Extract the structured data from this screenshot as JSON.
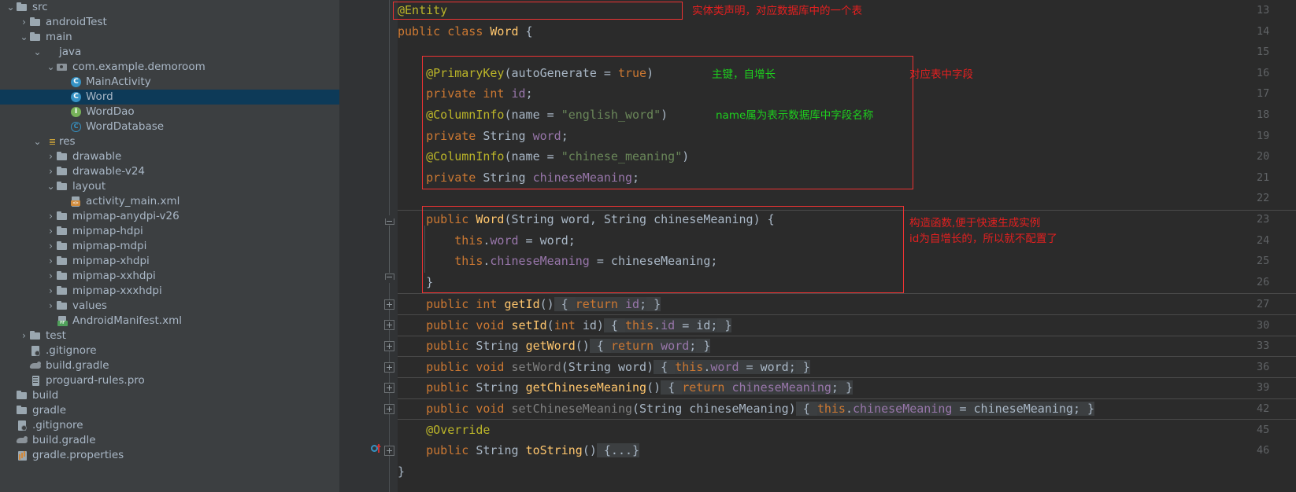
{
  "sidebar": {
    "items": [
      {
        "label": "src",
        "depth": 1,
        "arrow": "▾",
        "icon": "folder",
        "indent": 7
      },
      {
        "label": "androidTest",
        "depth": 2,
        "arrow": "›",
        "icon": "folder",
        "indent": 24
      },
      {
        "label": "main",
        "depth": 2,
        "arrow": "▾",
        "icon": "folder",
        "indent": 24
      },
      {
        "label": "java",
        "depth": 3,
        "arrow": "▾",
        "icon": "folder-blue",
        "indent": 41
      },
      {
        "label": "com.example.demoroom",
        "depth": 4,
        "arrow": "▾",
        "icon": "pkg",
        "indent": 58
      },
      {
        "label": "MainActivity",
        "depth": 5,
        "arrow": "",
        "icon": "cls",
        "indent": 75
      },
      {
        "label": "Word",
        "depth": 5,
        "arrow": "",
        "icon": "cls",
        "indent": 75,
        "selected": true
      },
      {
        "label": "WordDao",
        "depth": 5,
        "arrow": "",
        "icon": "iface",
        "indent": 75
      },
      {
        "label": "WordDatabase",
        "depth": 5,
        "arrow": "",
        "icon": "absc",
        "indent": 75
      },
      {
        "label": "res",
        "depth": 3,
        "arrow": "▾",
        "icon": "folder-res",
        "indent": 41
      },
      {
        "label": "drawable",
        "depth": 4,
        "arrow": "›",
        "icon": "folder",
        "indent": 58
      },
      {
        "label": "drawable-v24",
        "depth": 4,
        "arrow": "›",
        "icon": "folder",
        "indent": 58
      },
      {
        "label": "layout",
        "depth": 4,
        "arrow": "▾",
        "icon": "folder",
        "indent": 58
      },
      {
        "label": "activity_main.xml",
        "depth": 5,
        "arrow": "",
        "icon": "xml",
        "indent": 75
      },
      {
        "label": "mipmap-anydpi-v26",
        "depth": 4,
        "arrow": "›",
        "icon": "folder",
        "indent": 58
      },
      {
        "label": "mipmap-hdpi",
        "depth": 4,
        "arrow": "›",
        "icon": "folder",
        "indent": 58
      },
      {
        "label": "mipmap-mdpi",
        "depth": 4,
        "arrow": "›",
        "icon": "folder",
        "indent": 58
      },
      {
        "label": "mipmap-xhdpi",
        "depth": 4,
        "arrow": "›",
        "icon": "folder",
        "indent": 58
      },
      {
        "label": "mipmap-xxhdpi",
        "depth": 4,
        "arrow": "›",
        "icon": "folder",
        "indent": 58
      },
      {
        "label": "mipmap-xxxhdpi",
        "depth": 4,
        "arrow": "›",
        "icon": "folder",
        "indent": 58
      },
      {
        "label": "values",
        "depth": 4,
        "arrow": "›",
        "icon": "folder",
        "indent": 58
      },
      {
        "label": "AndroidManifest.xml",
        "depth": 4,
        "arrow": "",
        "icon": "mf",
        "indent": 58
      },
      {
        "label": "test",
        "depth": 2,
        "arrow": "›",
        "icon": "folder",
        "indent": 24
      },
      {
        "label": ".gitignore",
        "depth": 2,
        "arrow": "",
        "icon": "git",
        "indent": 24
      },
      {
        "label": "build.gradle",
        "depth": 2,
        "arrow": "",
        "icon": "gradle",
        "indent": 24
      },
      {
        "label": "proguard-rules.pro",
        "depth": 2,
        "arrow": "",
        "icon": "pro",
        "indent": 24
      },
      {
        "label": "build",
        "depth": 0,
        "arrow": "",
        "icon": "folder",
        "indent": 7
      },
      {
        "label": "gradle",
        "depth": 0,
        "arrow": "",
        "icon": "folder",
        "indent": 7
      },
      {
        "label": ".gitignore",
        "depth": 0,
        "arrow": "",
        "icon": "git",
        "indent": 7
      },
      {
        "label": "build.gradle",
        "depth": 0,
        "arrow": "",
        "icon": "gradle",
        "indent": 7
      },
      {
        "label": "gradle.properties",
        "depth": 0,
        "arrow": "",
        "icon": "props",
        "indent": 7
      }
    ]
  },
  "editor": {
    "line_numbers": [
      "13",
      "14",
      "15",
      "16",
      "17",
      "18",
      "19",
      "20",
      "21",
      "22",
      "23",
      "24",
      "25",
      "26",
      "27",
      "30",
      "33",
      "36",
      "39",
      "42",
      "45",
      "46"
    ],
    "lines": [
      {
        "n": "13",
        "text": "@Entity"
      },
      {
        "n": "14",
        "text": "public class Word {"
      },
      {
        "n": "15",
        "text": ""
      },
      {
        "n": "16",
        "text": "    @PrimaryKey(autoGenerate = true)"
      },
      {
        "n": "17",
        "text": "    private int id;"
      },
      {
        "n": "18",
        "text": "    @ColumnInfo(name = \"english_word\")"
      },
      {
        "n": "19",
        "text": "    private String word;"
      },
      {
        "n": "20",
        "text": "    @ColumnInfo(name = \"chinese_meaning\")"
      },
      {
        "n": "21",
        "text": "    private String chineseMeaning;"
      },
      {
        "n": "22",
        "text": ""
      },
      {
        "n": "23",
        "text": "    public Word(String word, String chineseMeaning) {"
      },
      {
        "n": "24",
        "text": "        this.word = word;"
      },
      {
        "n": "25",
        "text": "        this.chineseMeaning = chineseMeaning;"
      },
      {
        "n": "26",
        "text": "    }"
      },
      {
        "n": "27",
        "text": "    public int getId() { return id; }"
      },
      {
        "n": "30",
        "text": "    public void setId(int id) { this.id = id; }"
      },
      {
        "n": "33",
        "text": "    public String getWord() { return word; }"
      },
      {
        "n": "36",
        "text": "    public void setWord(String word) { this.word = word; }"
      },
      {
        "n": "39",
        "text": "    public String getChineseMeaning() { return chineseMeaning; }"
      },
      {
        "n": "42",
        "text": "    public void setChineseMeaning(String chineseMeaning) { this.chineseMeaning = chineseMeaning; }"
      },
      {
        "n": "45",
        "text": "    @Override"
      },
      {
        "n": "46",
        "text": "    public String toString() {...}"
      }
    ],
    "tokens": {
      "entity": "@Entity",
      "kw_public": "public",
      "kw_class": "class",
      "kw_private": "private",
      "kw_int": "int",
      "kw_void": "void",
      "kw_return": "return",
      "kw_this": "this",
      "kw_true": "true",
      "type_string": "String",
      "cls_word": "Word",
      "primarykey": "@PrimaryKey",
      "columninfo": "@ColumnInfo",
      "override": "@Override",
      "name_arg": "name",
      "autogen": "autoGenerate",
      "str_english": "\"english_word\"",
      "str_chinese": "\"chinese_meaning\"",
      "f_id": "id",
      "f_word": "word",
      "f_cm": "chineseMeaning",
      "m_getId": "getId",
      "m_setId": "setId",
      "m_getWord": "getWord",
      "m_setWord": "setWord",
      "m_getCM": "getChineseMeaning",
      "m_setCM": "setChineseMeaning",
      "m_toString": "toString",
      "folded_body": "{...}"
    },
    "annotations": [
      {
        "id": "a1",
        "text": "实体类声明，对应数据库中的一个表",
        "color": "#e32020"
      },
      {
        "id": "a2",
        "text": "主键，自增长",
        "color": "#1ecf1e"
      },
      {
        "id": "a3",
        "text": "name属为表示数据库中字段名称",
        "color": "#1ecf1e"
      },
      {
        "id": "a4",
        "text": "对应表中字段",
        "color": "#e32020"
      },
      {
        "id": "a5",
        "text": "构造函数,便于快速生成实例",
        "color": "#e32020"
      },
      {
        "id": "a6",
        "text": "id为自增长的，所以就不配置了",
        "color": "#e32020"
      }
    ],
    "gutter_icon": "override-marker-icon"
  },
  "colors": {
    "editor_bg": "#2b2b2b",
    "panel_bg": "#3c3f41",
    "gutter_bg": "#313335",
    "selection_bg": "#0d3a58",
    "keyword": "#cc7832",
    "annotation": "#bbb529",
    "string": "#6a8759",
    "number": "#6897bb",
    "field": "#9876aa",
    "method": "#ffc66d",
    "default_text": "#a9b7c6",
    "line_number": "#606366",
    "note_red": "#e32020",
    "note_green": "#1ecf1e"
  }
}
